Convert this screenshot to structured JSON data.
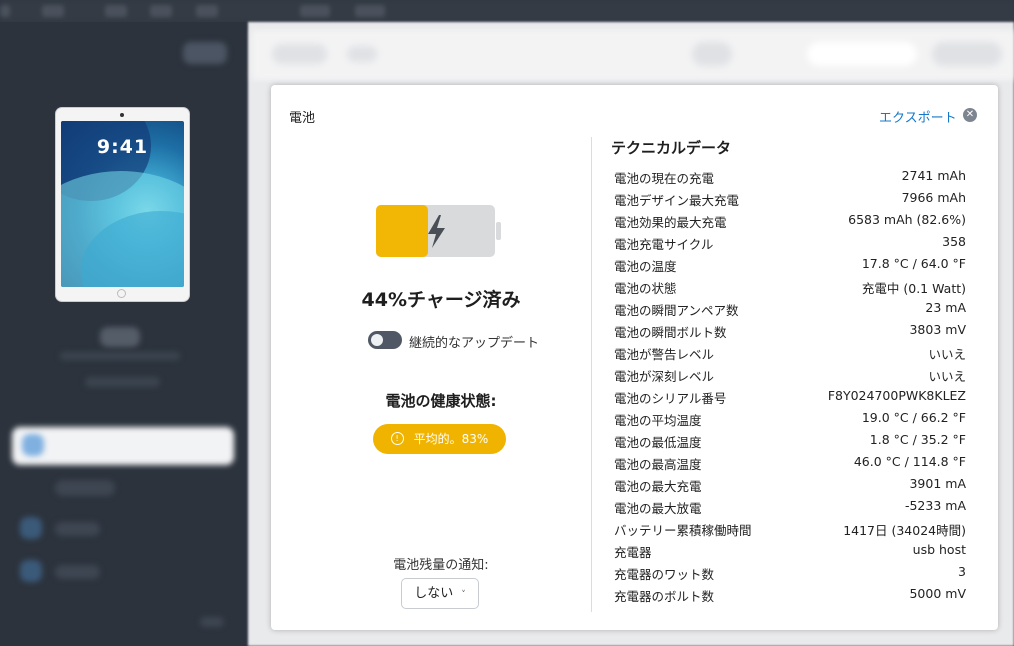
{
  "panel": {
    "title": "電池",
    "export_label": "エクスポート",
    "close_icon": "close-icon"
  },
  "battery": {
    "level_percent": 44,
    "charge_text": "44%チャージ済み",
    "fill_color": "#f2b705",
    "icon": "lightning-bolt-icon",
    "continuous_update_label": "継続的なアップデート",
    "continuous_update_on": false,
    "health_title": "電池の健康状態:",
    "health_badge": "平均的。83%",
    "health_icon": "info-icon",
    "health_color": "#f0b400",
    "notify_label": "電池残量の通知:",
    "notify_value": "しない"
  },
  "tech": {
    "title": "テクニカルデータ",
    "rows": [
      {
        "key": "電池の現在の充電",
        "value": "2741 mAh"
      },
      {
        "key": "電池デザイン最大充電",
        "value": "7966 mAh"
      },
      {
        "key": "電池効果的最大充電",
        "value": "6583 mAh (82.6%)"
      },
      {
        "key": "電池充電サイクル",
        "value": "358"
      },
      {
        "key": "電池の温度",
        "value": "17.8 °C / 64.0 °F"
      },
      {
        "key": "電池の状態",
        "value": "充電中 (0.1 Watt)"
      },
      {
        "key": "電池の瞬間アンペア数",
        "value": "23 mA"
      },
      {
        "key": "電池の瞬間ボルト数",
        "value": "3803 mV"
      },
      {
        "key": "電池が警告レベル",
        "value": "いいえ"
      },
      {
        "key": "電池が深刻レベル",
        "value": "いいえ"
      },
      {
        "key": "電池のシリアル番号",
        "value": "F8Y024700PWK8KLEZ"
      },
      {
        "key": "電池の平均温度",
        "value": "19.0 °C / 66.2 °F"
      },
      {
        "key": "電池の最低温度",
        "value": "1.8 °C / 35.2 °F"
      },
      {
        "key": "電池の最高温度",
        "value": "46.0 °C / 114.8 °F"
      },
      {
        "key": "電池の最大充電",
        "value": "3901 mA"
      },
      {
        "key": "電池の最大放電",
        "value": "-5233 mA"
      },
      {
        "key": "バッテリー累積稼働時間",
        "value": "1417日 (34024時間)"
      },
      {
        "key": "充電器",
        "value": "usb host"
      },
      {
        "key": "充電器のワット数",
        "value": "3"
      },
      {
        "key": "充電器のボルト数",
        "value": "5000 mV"
      }
    ]
  },
  "device": {
    "lock_time": "9:41"
  }
}
